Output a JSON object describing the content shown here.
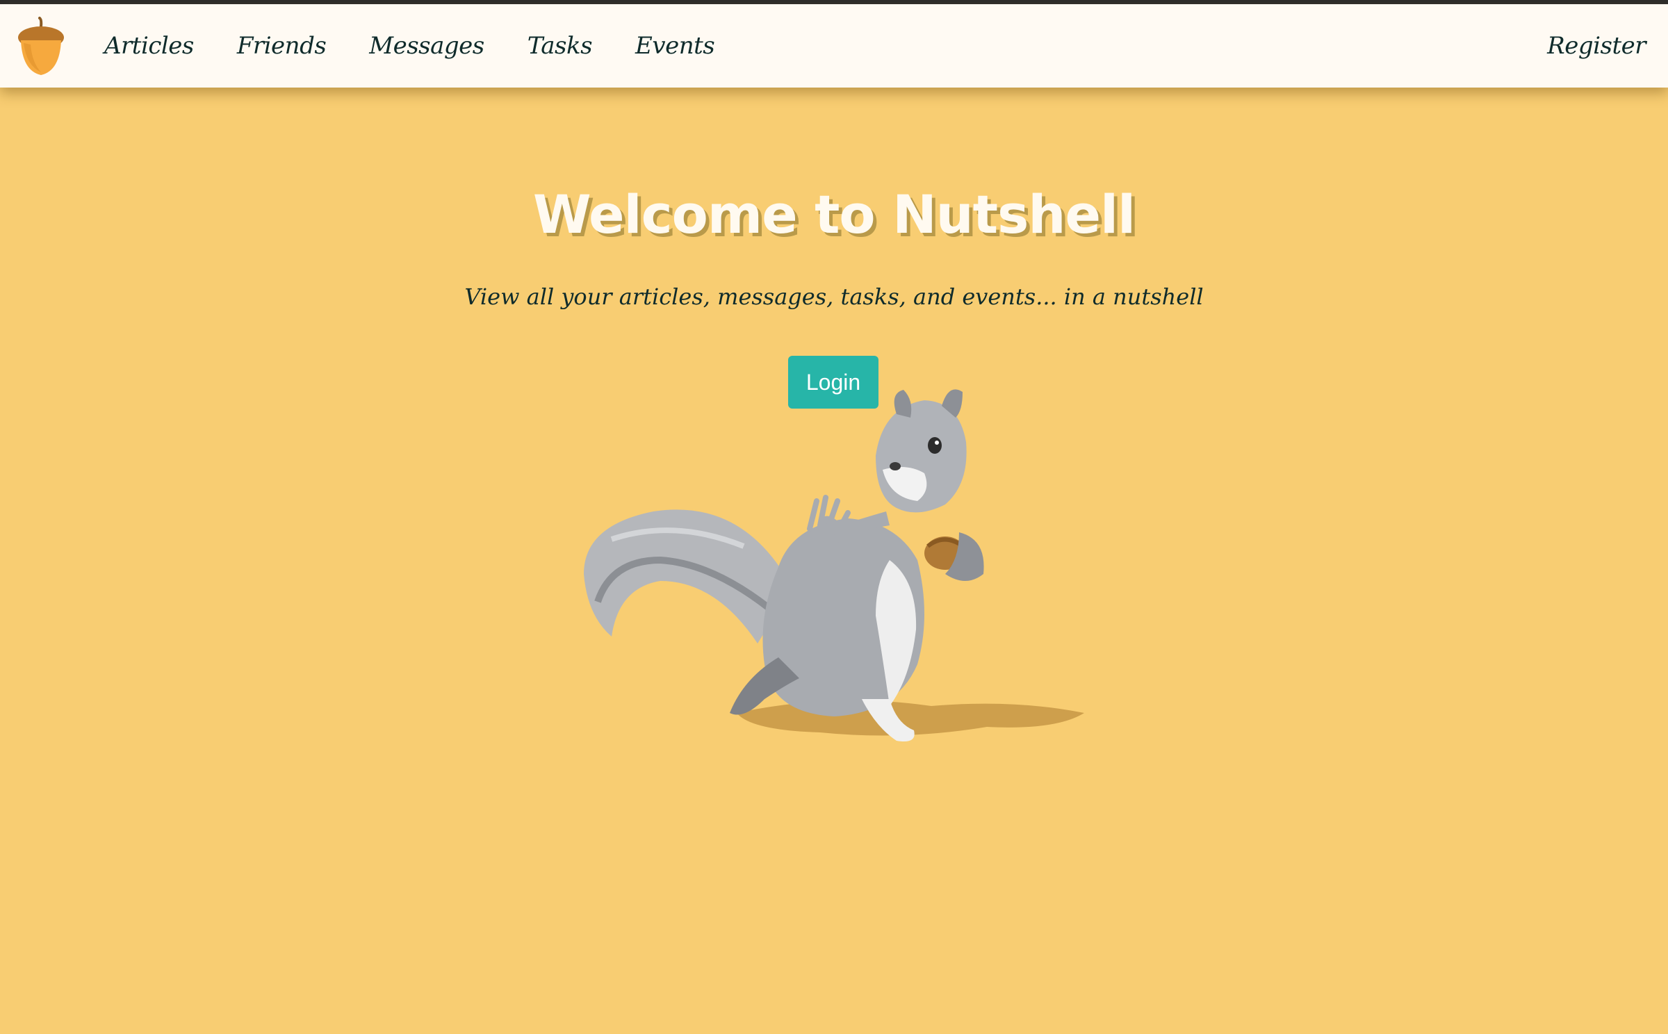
{
  "nav": {
    "logo_icon": "acorn-icon",
    "links": [
      {
        "label": "Articles"
      },
      {
        "label": "Friends"
      },
      {
        "label": "Messages"
      },
      {
        "label": "Tasks"
      },
      {
        "label": "Events"
      }
    ],
    "register_label": "Register"
  },
  "hero": {
    "title": "Welcome to Nutshell",
    "subtitle": "View all your articles, messages, tasks, and events... in a nutshell",
    "login_label": "Login",
    "illustration_icon": "squirrel-icon"
  },
  "colors": {
    "background": "#f8cd72",
    "navbar": "#fffaf3",
    "nav_text": "#0f2b2b",
    "button": "#27b5a8",
    "title_text": "#fffaf0"
  }
}
